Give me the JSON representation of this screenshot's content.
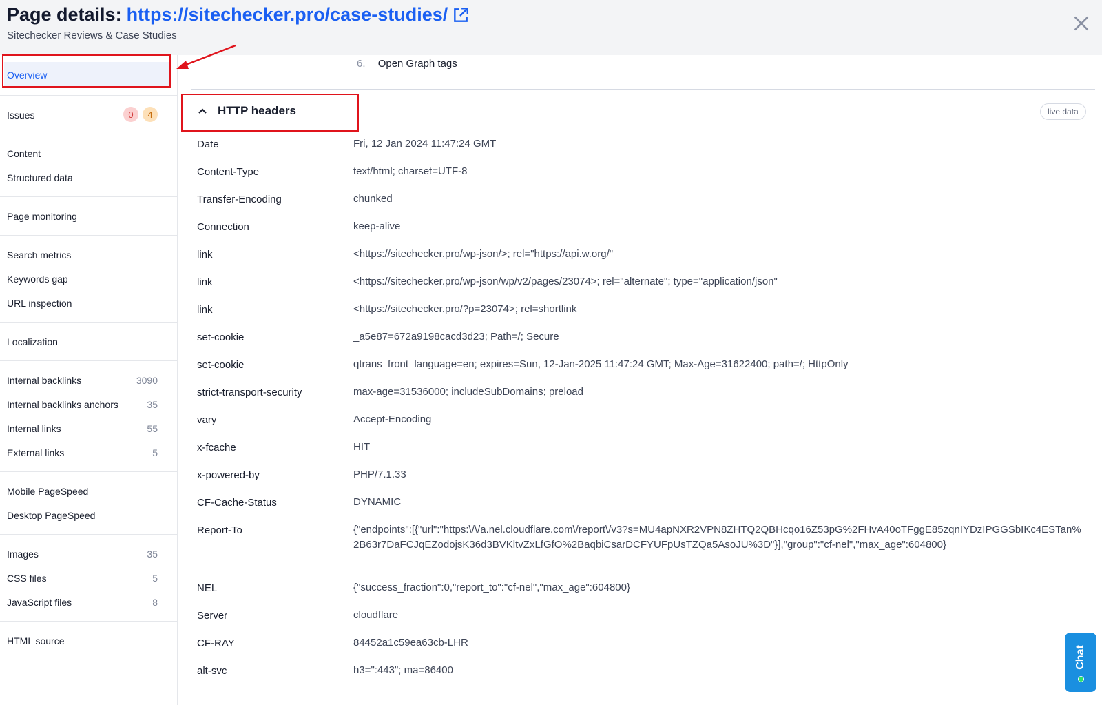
{
  "header": {
    "title_prefix": "Page details:",
    "url": "https://sitechecker.pro/case-studies/",
    "subtitle": "Sitechecker Reviews & Case Studies"
  },
  "sidebar": {
    "groups": [
      [
        {
          "label": "Overview",
          "active": true
        }
      ],
      [
        {
          "label": "Issues",
          "badges": [
            "0",
            "4"
          ]
        }
      ],
      [
        {
          "label": "Content"
        },
        {
          "label": "Structured data"
        }
      ],
      [
        {
          "label": "Page monitoring"
        }
      ],
      [
        {
          "label": "Search metrics"
        },
        {
          "label": "Keywords gap"
        },
        {
          "label": "URL inspection"
        }
      ],
      [
        {
          "label": "Localization"
        }
      ],
      [
        {
          "label": "Internal backlinks",
          "count": "3090"
        },
        {
          "label": "Internal backlinks anchors",
          "count": "35"
        },
        {
          "label": "Internal links",
          "count": "55"
        },
        {
          "label": "External links",
          "count": "5"
        }
      ],
      [
        {
          "label": "Mobile PageSpeed"
        },
        {
          "label": "Desktop PageSpeed"
        }
      ],
      [
        {
          "label": "Images",
          "count": "35"
        },
        {
          "label": "CSS files",
          "count": "5"
        },
        {
          "label": "JavaScript files",
          "count": "8"
        }
      ],
      [
        {
          "label": "HTML source"
        }
      ]
    ]
  },
  "main": {
    "prev_list_item": {
      "num": "6.",
      "label": "Open Graph tags"
    },
    "section_title": "HTTP headers",
    "live_badge": "live data",
    "headers": [
      {
        "k": "Date",
        "v": "Fri, 12 Jan 2024 11:47:24 GMT"
      },
      {
        "k": "Content-Type",
        "v": "text/html; charset=UTF-8"
      },
      {
        "k": "Transfer-Encoding",
        "v": "chunked"
      },
      {
        "k": "Connection",
        "v": "keep-alive"
      },
      {
        "k": "link",
        "v": "<https://sitechecker.pro/wp-json/>; rel=\"https://api.w.org/\""
      },
      {
        "k": "link",
        "v": "<https://sitechecker.pro/wp-json/wp/v2/pages/23074>; rel=\"alternate\"; type=\"application/json\""
      },
      {
        "k": "link",
        "v": "<https://sitechecker.pro/?p=23074>; rel=shortlink"
      },
      {
        "k": "set-cookie",
        "v": "_a5e87=672a9198cacd3d23; Path=/; Secure"
      },
      {
        "k": "set-cookie",
        "v": "qtrans_front_language=en; expires=Sun, 12-Jan-2025 11:47:24 GMT; Max-Age=31622400; path=/; HttpOnly"
      },
      {
        "k": "strict-transport-security",
        "v": "max-age=31536000; includeSubDomains; preload"
      },
      {
        "k": "vary",
        "v": "Accept-Encoding"
      },
      {
        "k": "x-fcache",
        "v": "HIT"
      },
      {
        "k": "x-powered-by",
        "v": "PHP/7.1.33"
      },
      {
        "k": "CF-Cache-Status",
        "v": "DYNAMIC"
      },
      {
        "k": "Report-To",
        "v": "{\"endpoints\":[{\"url\":\"https:\\/\\/a.nel.cloudflare.com\\/report\\/v3?s=MU4apNXR2VPN8ZHTQ2QBHcqo16Z53pG%2FHvA40oTFggE85zqnIYDzIPGGSbIKc4ESTan%2B63r7DaFCJqEZodojsK36d3BVKltvZxLfGfO%2BaqbiCsarDCFYUFpUsTZQa5AsoJU%3D\"}],\"group\":\"cf-nel\",\"max_age\":604800}"
      },
      {
        "k": "NEL",
        "v": "{\"success_fraction\":0,\"report_to\":\"cf-nel\",\"max_age\":604800}"
      },
      {
        "k": "Server",
        "v": "cloudflare"
      },
      {
        "k": "CF-RAY",
        "v": "84452a1c59ea63cb-LHR"
      },
      {
        "k": "alt-svc",
        "v": "h3=\":443\"; ma=86400"
      }
    ]
  },
  "chat": {
    "label": "Chat"
  },
  "colors": {
    "accent": "#1a5ff2",
    "annotation": "#e0141c",
    "chat": "#1a8fe0"
  }
}
